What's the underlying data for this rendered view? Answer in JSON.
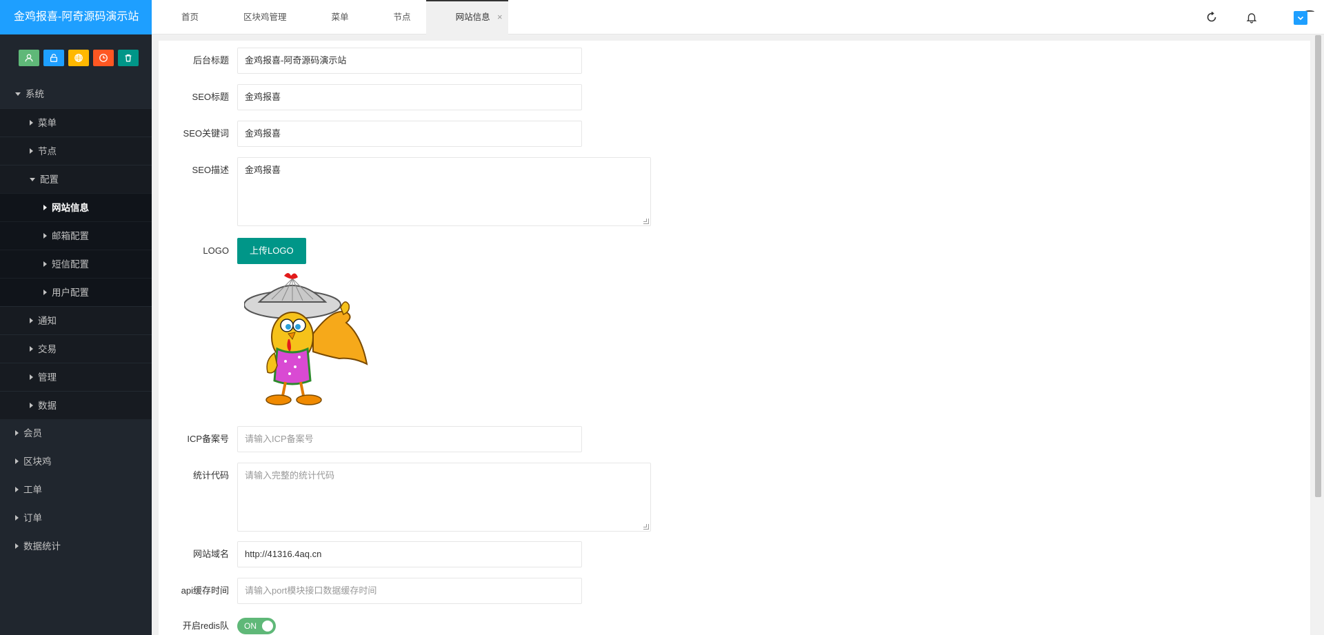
{
  "app": {
    "title": "金鸡报喜-阿奇源码演示站"
  },
  "quick_buttons": [
    {
      "icon": "user-icon",
      "color": "#5FB878"
    },
    {
      "icon": "lock-icon",
      "color": "#1E9FFF"
    },
    {
      "icon": "globe-icon",
      "color": "#FFB800"
    },
    {
      "icon": "clock-icon",
      "color": "#FF5722"
    },
    {
      "icon": "trash-icon",
      "color": "#009688"
    }
  ],
  "sidebar": {
    "system": "系统",
    "menu": "菜单",
    "node": "节点",
    "config": "配置",
    "site_info": "网站信息",
    "mail_config": "邮箱配置",
    "sms_config": "短信配置",
    "user_config": "用户配置",
    "notice": "通知",
    "trade": "交易",
    "manage": "管理",
    "data": "数据",
    "member": "会员",
    "chicken": "区块鸡",
    "ticket": "工单",
    "order": "订单",
    "stats": "数据统计"
  },
  "tabs": [
    {
      "label": "首页"
    },
    {
      "label": "区块鸡管理"
    },
    {
      "label": "菜单"
    },
    {
      "label": "节点"
    },
    {
      "label": "网站信息",
      "close": "×"
    }
  ],
  "form": {
    "admin_title": {
      "label": "后台标题",
      "value": "金鸡报喜-阿奇源码演示站"
    },
    "seo_title": {
      "label": "SEO标题",
      "value": "金鸡报喜"
    },
    "seo_keywords": {
      "label": "SEO关键词",
      "value": "金鸡报喜"
    },
    "seo_desc": {
      "label": "SEO描述",
      "value": "金鸡报喜"
    },
    "logo": {
      "label": "LOGO",
      "button": "上传LOGO"
    },
    "icp": {
      "label": "ICP备案号",
      "placeholder": "请输入ICP备案号"
    },
    "stats_code": {
      "label": "统计代码",
      "placeholder": "请输入完整的统计代码"
    },
    "domain": {
      "label": "网站域名",
      "value": "http://41316.4aq.cn"
    },
    "api_cache": {
      "label": "api缓存时间",
      "placeholder": "请输入port模块接口数据缓存时间"
    },
    "redis": {
      "label": "开启redis队",
      "switch_text": "ON"
    }
  },
  "colors": {
    "brand": "#1E9FFF",
    "sidebar_bg": "#20262E",
    "primary_btn": "#009688",
    "switch_on": "#5FB878"
  }
}
